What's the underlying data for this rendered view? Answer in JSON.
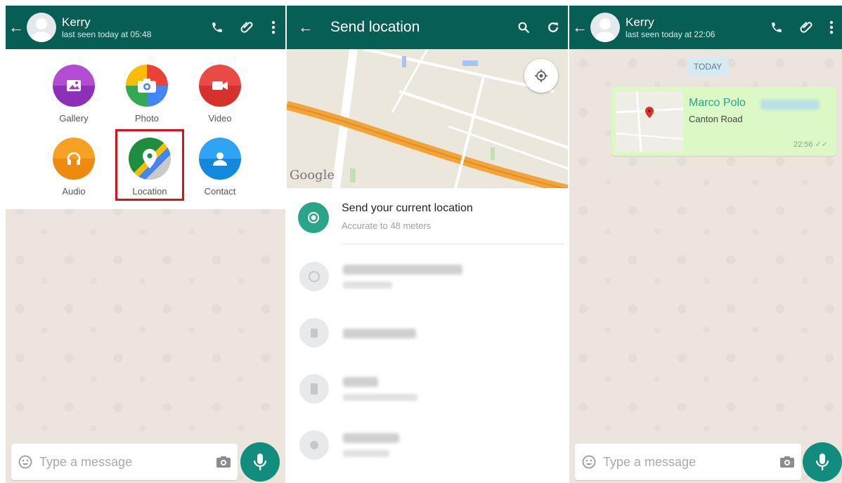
{
  "chat_left": {
    "contact_name": "Kerry",
    "last_seen": "last seen today at 05:48",
    "attach_menu": [
      {
        "label": "Gallery",
        "icon": "gallery-icon",
        "color": "#a23fc9"
      },
      {
        "label": "Photo",
        "icon": "camera-icon",
        "color": "#ea4335"
      },
      {
        "label": "Video",
        "icon": "video-icon",
        "color": "#e33e3a"
      },
      {
        "label": "Audio",
        "icon": "headphones-icon",
        "color": "#f18e16"
      },
      {
        "label": "Location",
        "icon": "maps-pin-icon",
        "color": "#1e8e3e"
      },
      {
        "label": "Contact",
        "icon": "person-icon",
        "color": "#1d9bf0"
      }
    ],
    "input_placeholder": "Type a message"
  },
  "send_location": {
    "title": "Send location",
    "current_location_title": "Send your current location",
    "current_location_accuracy": "Accurate to 48 meters",
    "map_attribution": "Google",
    "nearby_places_count_visible": 4
  },
  "chat_right": {
    "contact_name": "Kerry",
    "last_seen": "last seen today at 22:06",
    "date_chip": "TODAY",
    "location_message": {
      "place_name": "Marco Polo",
      "address": "Canton Road",
      "time": "22:56",
      "ticks": "✓✓"
    },
    "input_placeholder": "Type a message"
  },
  "colors": {
    "header": "#075e54",
    "accent": "#128c7e",
    "chat_wallpaper": "#ece5dd",
    "outgoing_bubble": "#dcf8c6",
    "highlight_box": "#d4141c"
  }
}
